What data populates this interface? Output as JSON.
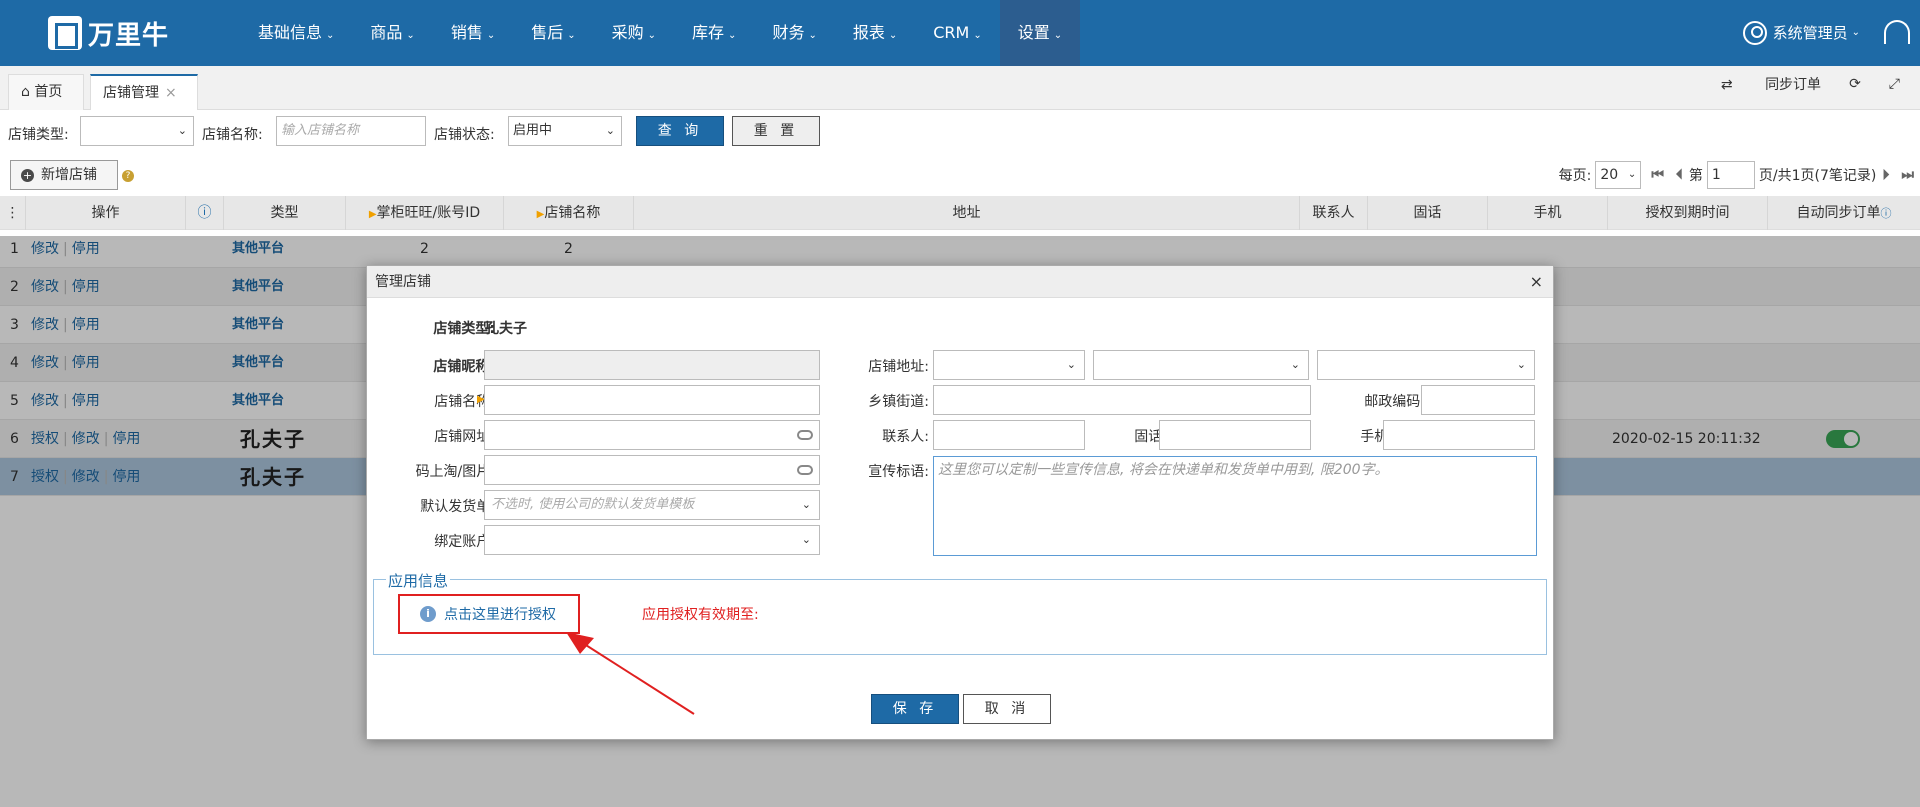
{
  "app": {
    "logo_text": "万里牛"
  },
  "nav": [
    {
      "label": "基础信息"
    },
    {
      "label": "商品"
    },
    {
      "label": "销售"
    },
    {
      "label": "售后"
    },
    {
      "label": "采购"
    },
    {
      "label": "库存"
    },
    {
      "label": "财务"
    },
    {
      "label": "报表"
    },
    {
      "label": "CRM"
    },
    {
      "label": "设置"
    }
  ],
  "user": {
    "name": "系统管理员"
  },
  "tabs": {
    "home": "首页",
    "shop": "店铺管理",
    "close": "×"
  },
  "tools": {
    "sync": "同步订单"
  },
  "filter": {
    "type_label": "店铺类型:",
    "type_value": "",
    "name_label": "店铺名称:",
    "name_placeholder": "输入店铺名称",
    "status_label": "店铺状态:",
    "status_value": "启用中",
    "query": "查 询",
    "reset": "重 置"
  },
  "toolbar": {
    "add_shop": "新增店铺"
  },
  "pager": {
    "per_page_label": "每页:",
    "per_page": "20",
    "page_prefix": "第",
    "page": "1",
    "page_suffix": "页/共1页(7笔记录)"
  },
  "table": {
    "headers": [
      "操作",
      "类型",
      "掌柜旺旺/账号ID",
      "店铺名称",
      "地址",
      "联系人",
      "固话",
      "手机",
      "授权到期时间",
      "自动同步订单"
    ],
    "rows": [
      {
        "no": "1",
        "a1": "修改",
        "a2": "停用",
        "a3": "",
        "type": "其他平台",
        "acct": "2",
        "name": "2",
        "expiry": ""
      },
      {
        "no": "2",
        "a1": "修改",
        "a2": "停用",
        "a3": "",
        "type": "其他平台",
        "acct": "",
        "name": "",
        "expiry": ""
      },
      {
        "no": "3",
        "a1": "修改",
        "a2": "停用",
        "a3": "",
        "type": "其他平台",
        "acct": "",
        "name": "",
        "expiry": ""
      },
      {
        "no": "4",
        "a1": "修改",
        "a2": "停用",
        "a3": "",
        "type": "其他平台",
        "acct": "",
        "name": "",
        "expiry": ""
      },
      {
        "no": "5",
        "a1": "修改",
        "a2": "停用",
        "a3": "",
        "type": "其他平台",
        "acct": "",
        "name": "",
        "expiry": ""
      },
      {
        "no": "6",
        "a1": "授权",
        "a2": "修改",
        "a3": "停用",
        "type": "孔夫子",
        "acct": "",
        "name": "",
        "expiry": "2020-02-15 20:11:32"
      },
      {
        "no": "7",
        "a1": "授权",
        "a2": "修改",
        "a3": "停用",
        "type": "孔夫子",
        "acct": "",
        "name": "",
        "expiry": ""
      }
    ]
  },
  "dialog": {
    "title": "管理店铺",
    "close": "×",
    "shop_type_label": "店铺类型:",
    "shop_type_value": "孔夫子",
    "nickname_label": "店铺昵称:",
    "name_label": "店铺名称:",
    "url_label": "店铺网址:",
    "code_label": "码上淘/图片:",
    "default_invoice_label": "默认发货单:",
    "default_invoice_placeholder": "不选时, 使用公司的默认发货单模板",
    "bind_account_label": "绑定账户:",
    "address_label": "店铺地址:",
    "street_label": "乡镇街道:",
    "zip_label": "邮政编码:",
    "contact_label": "联系人:",
    "phone_label": "固话:",
    "mobile_label": "手机:",
    "slogan_label": "宣传标语:",
    "slogan_placeholder": "这里您可以定制一些宣传信息, 将会在快递单和发货单中用到, 限200字。",
    "app_info_legend": "应用信息",
    "auth_link": "点击这里进行授权",
    "auth_expiry_label": "应用授权有效期至:",
    "save": "保 存",
    "cancel": "取 消"
  },
  "colors": {
    "primary": "#1e6aa6",
    "nav_active": "#2c5d8f",
    "highlight_red": "#e02020",
    "toggle_on": "#3aa756"
  }
}
